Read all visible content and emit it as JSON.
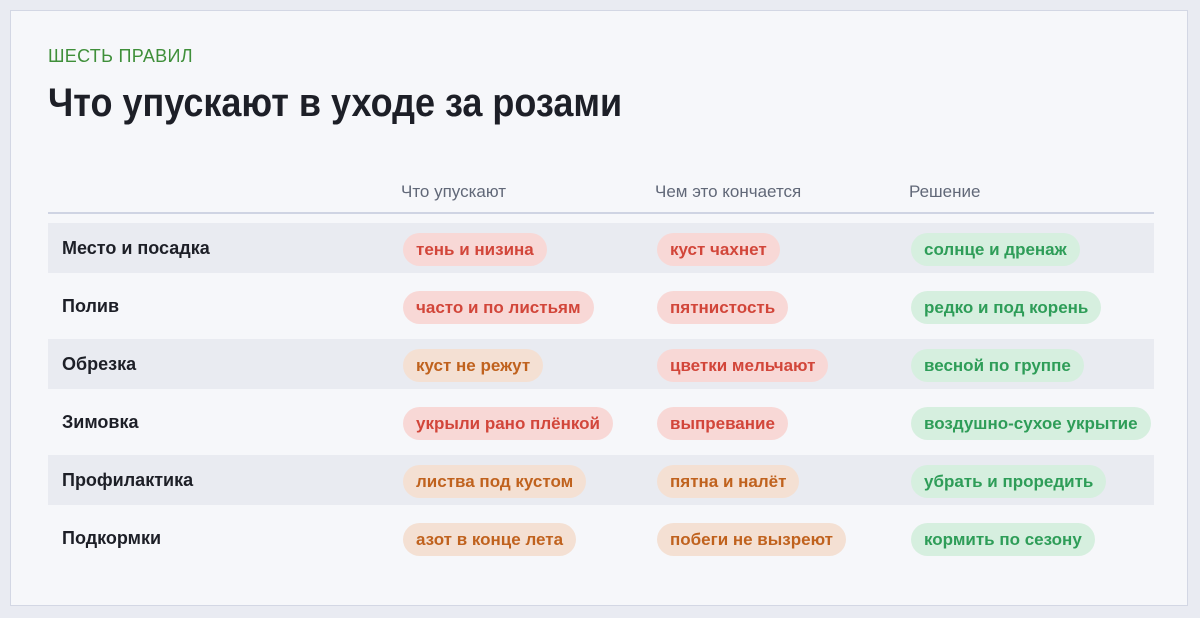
{
  "header": {
    "eyebrow": "ШЕСТЬ ПРАВИЛ",
    "title": "Что упускают в уходе за розами"
  },
  "columns": [
    "",
    "Что упускают",
    "Чем это кончается",
    "Решение"
  ],
  "colors": {
    "red_pill_bg": "#f8d8d6",
    "red_pill_text": "#d2463a",
    "orange_pill_bg": "#f4e0d3",
    "orange_pill_text": "#c0621e",
    "green_pill_bg": "#d6efdf",
    "green_pill_text": "#2e9d58",
    "eyebrow": "#3f8f3a"
  },
  "rows": [
    {
      "label": "Место и посадка",
      "mistake": "тень и низина",
      "mistake_tone": "red",
      "result": "куст чахнет",
      "result_tone": "red",
      "fix": "солнце и дренаж"
    },
    {
      "label": "Полив",
      "mistake": "часто и по листьям",
      "mistake_tone": "red",
      "result": "пятнистость",
      "result_tone": "red",
      "fix": "редко и под корень"
    },
    {
      "label": "Обрезка",
      "mistake": "куст не режут",
      "mistake_tone": "orange",
      "result": "цветки мельчают",
      "result_tone": "red",
      "fix": "весной по группе"
    },
    {
      "label": "Зимовка",
      "mistake": "укрыли рано плёнкой",
      "mistake_tone": "red",
      "result": "выпревание",
      "result_tone": "red",
      "fix": "воздушно-сухое укрытие"
    },
    {
      "label": "Профилактика",
      "mistake": "листва под кустом",
      "mistake_tone": "orange",
      "result": "пятна и налёт",
      "result_tone": "orange",
      "fix": "убрать и проредить"
    },
    {
      "label": "Подкормки",
      "mistake": "азот в конце лета",
      "mistake_tone": "orange",
      "result": "побеги не вызреют",
      "result_tone": "orange",
      "fix": "кормить по сезону"
    }
  ]
}
